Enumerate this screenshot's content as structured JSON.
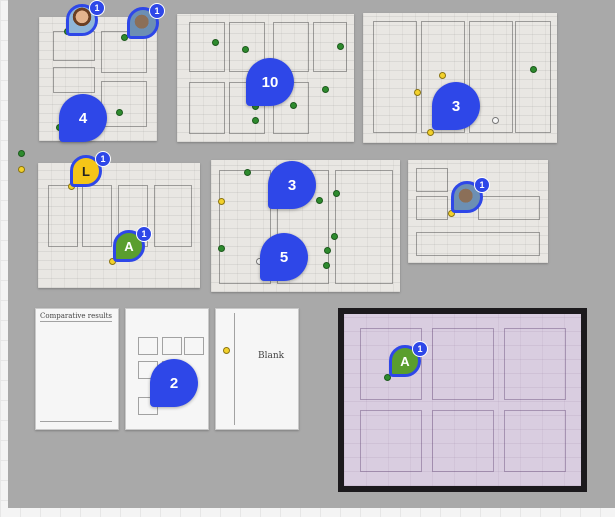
{
  "board": {
    "background": "#a9a9a9"
  },
  "colors": {
    "cluster": "#2e47e8",
    "green_dot": "#2e8b2e",
    "yellow_dot": "#f3d12b"
  },
  "clusters": {
    "c1": "4",
    "c2": "10",
    "c3": "3",
    "c4": "3",
    "c5": "5",
    "c6": "2"
  },
  "avatars": {
    "a1": {
      "letter": "",
      "badge": "1"
    },
    "a2": {
      "letter": "",
      "badge": "1"
    },
    "a3": {
      "letter": "L",
      "badge": "1"
    },
    "a4": {
      "letter": "A",
      "badge": "1"
    },
    "a5": {
      "letter": "",
      "badge": "1"
    },
    "a6": {
      "letter": "A",
      "badge": "1"
    }
  },
  "sketch_text": {
    "phone1_header": "Comparative results",
    "phone3_body": "Blank"
  }
}
